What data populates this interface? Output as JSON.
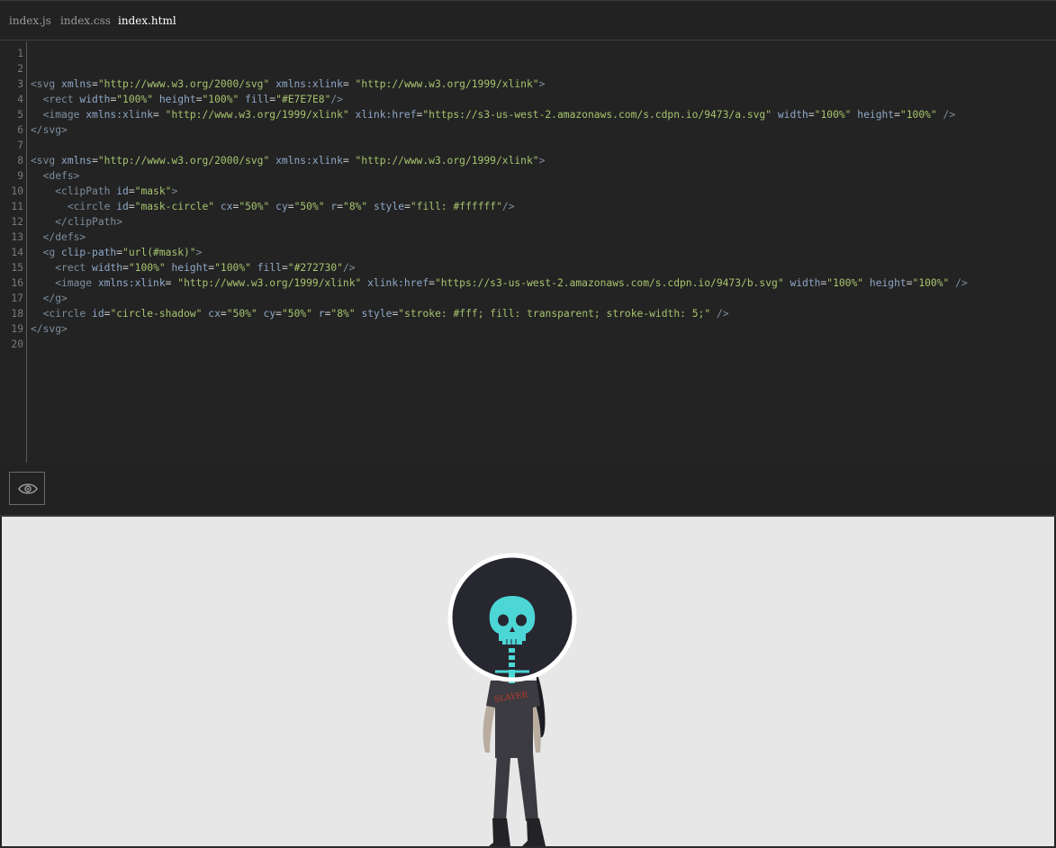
{
  "tabs": [
    {
      "label": "index.js",
      "active": false
    },
    {
      "label": "index.css",
      "active": false
    },
    {
      "label": "index.html",
      "active": true
    }
  ],
  "code_lines": [
    {
      "n": "1",
      "tokens": []
    },
    {
      "n": "2",
      "tokens": []
    },
    {
      "n": "3",
      "tokens": [
        [
          "tg",
          "<svg "
        ],
        [
          "at",
          "xmlns"
        ],
        [
          "pl",
          "="
        ],
        [
          "st",
          "\"http://www.w3.org/2000/svg\""
        ],
        [
          "pl",
          " "
        ],
        [
          "at",
          "xmlns:xlink"
        ],
        [
          "pl",
          "= "
        ],
        [
          "st",
          "\"http://www.w3.org/1999/xlink\""
        ],
        [
          "tg",
          ">"
        ]
      ]
    },
    {
      "n": "4",
      "tokens": [
        [
          "pl",
          "  "
        ],
        [
          "tg",
          "<rect "
        ],
        [
          "at",
          "width"
        ],
        [
          "pl",
          "="
        ],
        [
          "st",
          "\"100%\""
        ],
        [
          "pl",
          " "
        ],
        [
          "at",
          "height"
        ],
        [
          "pl",
          "="
        ],
        [
          "st",
          "\"100%\""
        ],
        [
          "pl",
          " "
        ],
        [
          "at",
          "fill"
        ],
        [
          "pl",
          "="
        ],
        [
          "st",
          "\"#E7E7E8\""
        ],
        [
          "tg",
          "/>"
        ]
      ]
    },
    {
      "n": "5",
      "tokens": [
        [
          "pl",
          "  "
        ],
        [
          "tg",
          "<image "
        ],
        [
          "at",
          "xmlns:xlink"
        ],
        [
          "pl",
          "= "
        ],
        [
          "st",
          "\"http://www.w3.org/1999/xlink\""
        ],
        [
          "pl",
          " "
        ],
        [
          "at",
          "xlink:href"
        ],
        [
          "pl",
          "="
        ],
        [
          "st",
          "\"https://s3-us-west-2.amazonaws.com/s.cdpn.io/9473/a.svg\""
        ],
        [
          "pl",
          " "
        ],
        [
          "at",
          "width"
        ],
        [
          "pl",
          "="
        ],
        [
          "st",
          "\"100%\""
        ],
        [
          "pl",
          " "
        ],
        [
          "at",
          "height"
        ],
        [
          "pl",
          "="
        ],
        [
          "st",
          "\"100%\""
        ],
        [
          "pl",
          " "
        ],
        [
          "tg",
          "/>"
        ]
      ]
    },
    {
      "n": "6",
      "tokens": [
        [
          "tg",
          "</svg>"
        ]
      ]
    },
    {
      "n": "7",
      "tokens": []
    },
    {
      "n": "8",
      "tokens": [
        [
          "tg",
          "<svg "
        ],
        [
          "at",
          "xmlns"
        ],
        [
          "pl",
          "="
        ],
        [
          "st",
          "\"http://www.w3.org/2000/svg\""
        ],
        [
          "pl",
          " "
        ],
        [
          "at",
          "xmlns:xlink"
        ],
        [
          "pl",
          "= "
        ],
        [
          "st",
          "\"http://www.w3.org/1999/xlink\""
        ],
        [
          "tg",
          ">"
        ]
      ]
    },
    {
      "n": "9",
      "tokens": [
        [
          "pl",
          "  "
        ],
        [
          "tg",
          "<defs>"
        ]
      ]
    },
    {
      "n": "10",
      "tokens": [
        [
          "pl",
          "    "
        ],
        [
          "tg",
          "<clipPath "
        ],
        [
          "at",
          "id"
        ],
        [
          "pl",
          "="
        ],
        [
          "st",
          "\"mask\""
        ],
        [
          "tg",
          ">"
        ]
      ]
    },
    {
      "n": "11",
      "tokens": [
        [
          "pl",
          "      "
        ],
        [
          "tg",
          "<circle "
        ],
        [
          "at",
          "id"
        ],
        [
          "pl",
          "="
        ],
        [
          "st",
          "\"mask-circle\""
        ],
        [
          "pl",
          " "
        ],
        [
          "at",
          "cx"
        ],
        [
          "pl",
          "="
        ],
        [
          "st",
          "\"50%\""
        ],
        [
          "pl",
          " "
        ],
        [
          "at",
          "cy"
        ],
        [
          "pl",
          "="
        ],
        [
          "st",
          "\"50%\""
        ],
        [
          "pl",
          " "
        ],
        [
          "at",
          "r"
        ],
        [
          "pl",
          "="
        ],
        [
          "st",
          "\"8%\""
        ],
        [
          "pl",
          " "
        ],
        [
          "at",
          "style"
        ],
        [
          "pl",
          "="
        ],
        [
          "st",
          "\"fill: #ffffff\""
        ],
        [
          "tg",
          "/>"
        ]
      ]
    },
    {
      "n": "12",
      "tokens": [
        [
          "pl",
          "    "
        ],
        [
          "tg",
          "</clipPath>"
        ]
      ]
    },
    {
      "n": "13",
      "tokens": [
        [
          "pl",
          "  "
        ],
        [
          "tg",
          "</defs>"
        ]
      ]
    },
    {
      "n": "14",
      "tokens": [
        [
          "pl",
          "  "
        ],
        [
          "tg",
          "<g "
        ],
        [
          "at",
          "clip-path"
        ],
        [
          "pl",
          "="
        ],
        [
          "st",
          "\"url(#mask)\""
        ],
        [
          "tg",
          ">"
        ]
      ]
    },
    {
      "n": "15",
      "tokens": [
        [
          "pl",
          "    "
        ],
        [
          "tg",
          "<rect "
        ],
        [
          "at",
          "width"
        ],
        [
          "pl",
          "="
        ],
        [
          "st",
          "\"100%\""
        ],
        [
          "pl",
          " "
        ],
        [
          "at",
          "height"
        ],
        [
          "pl",
          "="
        ],
        [
          "st",
          "\"100%\""
        ],
        [
          "pl",
          " "
        ],
        [
          "at",
          "fill"
        ],
        [
          "pl",
          "="
        ],
        [
          "st",
          "\"#272730\""
        ],
        [
          "tg",
          "/>"
        ]
      ]
    },
    {
      "n": "16",
      "tokens": [
        [
          "pl",
          "    "
        ],
        [
          "tg",
          "<image "
        ],
        [
          "at",
          "xmlns:xlink"
        ],
        [
          "pl",
          "= "
        ],
        [
          "st",
          "\"http://www.w3.org/1999/xlink\""
        ],
        [
          "pl",
          " "
        ],
        [
          "at",
          "xlink:href"
        ],
        [
          "pl",
          "="
        ],
        [
          "st",
          "\"https://s3-us-west-2.amazonaws.com/s.cdpn.io/9473/b.svg\""
        ],
        [
          "pl",
          " "
        ],
        [
          "at",
          "width"
        ],
        [
          "pl",
          "="
        ],
        [
          "st",
          "\"100%\""
        ],
        [
          "pl",
          " "
        ],
        [
          "at",
          "height"
        ],
        [
          "pl",
          "="
        ],
        [
          "st",
          "\"100%\""
        ],
        [
          "pl",
          " "
        ],
        [
          "tg",
          "/>"
        ]
      ]
    },
    {
      "n": "17",
      "tokens": [
        [
          "pl",
          "  "
        ],
        [
          "tg",
          "</g>"
        ]
      ]
    },
    {
      "n": "18",
      "tokens": [
        [
          "pl",
          "  "
        ],
        [
          "tg",
          "<circle "
        ],
        [
          "at",
          "id"
        ],
        [
          "pl",
          "="
        ],
        [
          "st",
          "\"circle-shadow\""
        ],
        [
          "pl",
          " "
        ],
        [
          "at",
          "cx"
        ],
        [
          "pl",
          "="
        ],
        [
          "st",
          "\"50%\""
        ],
        [
          "pl",
          " "
        ],
        [
          "at",
          "cy"
        ],
        [
          "pl",
          "="
        ],
        [
          "st",
          "\"50%\""
        ],
        [
          "pl",
          " "
        ],
        [
          "at",
          "r"
        ],
        [
          "pl",
          "="
        ],
        [
          "st",
          "\"8%\""
        ],
        [
          "pl",
          " "
        ],
        [
          "at",
          "style"
        ],
        [
          "pl",
          "="
        ],
        [
          "st",
          "\"stroke: #fff; fill: transparent; stroke-width: 5;\""
        ],
        [
          "pl",
          " "
        ],
        [
          "tg",
          "/>"
        ]
      ]
    },
    {
      "n": "19",
      "tokens": [
        [
          "tg",
          "</svg>"
        ]
      ]
    },
    {
      "n": "20",
      "tokens": []
    }
  ],
  "preview": {
    "toggle_icon": "eye-icon",
    "background": "#E7E7E8",
    "mask_fill": "#272730",
    "skull_color": "#4cd6d6",
    "shirt_text": "SLAYER",
    "shirt_text_color": "#c0392b"
  },
  "colors": {
    "editor_bg": "#232323",
    "tab_active": "#ffffff",
    "tab_inactive": "#9a9a9a",
    "tag": "#7e8e9e",
    "attr": "#8fa8c8",
    "string": "#a6c46e"
  }
}
